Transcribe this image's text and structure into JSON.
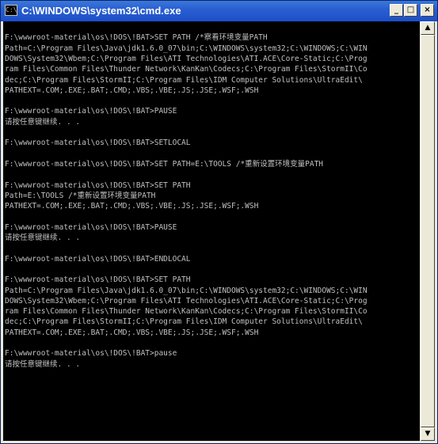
{
  "window": {
    "icon_text": "C:\\",
    "title": "C:\\WINDOWS\\system32\\cmd.exe",
    "buttons": {
      "minimize": "_",
      "maximize": "□",
      "close": "×"
    }
  },
  "console": {
    "lines": [
      "",
      "F:\\wwwroot-material\\os\\!DOS\\!BAT>SET PATH /*察看环境变量PATH",
      "Path=C:\\Program Files\\Java\\jdk1.6.0_07\\bin;C:\\WINDOWS\\system32;C:\\WINDOWS;C:\\WIN",
      "DOWS\\System32\\Wbem;C:\\Program Files\\ATI Technologies\\ATI.ACE\\Core-Static;C:\\Prog",
      "ram Files\\Common Files\\Thunder Network\\KanKan\\Codecs;C:\\Program Files\\StormII\\Co",
      "dec;C:\\Program Files\\StormII;C:\\Program Files\\IDM Computer Solutions\\UltraEdit\\",
      "PATHEXT=.COM;.EXE;.BAT;.CMD;.VBS;.VBE;.JS;.JSE;.WSF;.WSH",
      "",
      "F:\\wwwroot-material\\os\\!DOS\\!BAT>PAUSE",
      "请按任意键继续. . .",
      "",
      "F:\\wwwroot-material\\os\\!DOS\\!BAT>SETLOCAL",
      "",
      "F:\\wwwroot-material\\os\\!DOS\\!BAT>SET PATH=E:\\TOOLS /*重新设置环境变量PATH",
      "",
      "F:\\wwwroot-material\\os\\!DOS\\!BAT>SET PATH",
      "Path=E:\\TOOLS /*重新设置环境变量PATH",
      "PATHEXT=.COM;.EXE;.BAT;.CMD;.VBS;.VBE;.JS;.JSE;.WSF;.WSH",
      "",
      "F:\\wwwroot-material\\os\\!DOS\\!BAT>PAUSE",
      "请按任意键继续. . .",
      "",
      "F:\\wwwroot-material\\os\\!DOS\\!BAT>ENDLOCAL",
      "",
      "F:\\wwwroot-material\\os\\!DOS\\!BAT>SET PATH",
      "Path=C:\\Program Files\\Java\\jdk1.6.0_07\\bin;C:\\WINDOWS\\system32;C:\\WINDOWS;C:\\WIN",
      "DOWS\\System32\\Wbem;C:\\Program Files\\ATI Technologies\\ATI.ACE\\Core-Static;C:\\Prog",
      "ram Files\\Common Files\\Thunder Network\\KanKan\\Codecs;C:\\Program Files\\StormII\\Co",
      "dec;C:\\Program Files\\StormII;C:\\Program Files\\IDM Computer Solutions\\UltraEdit\\",
      "PATHEXT=.COM;.EXE;.BAT;.CMD;.VBS;.VBE;.JS;.JSE;.WSF;.WSH",
      "",
      "F:\\wwwroot-material\\os\\!DOS\\!BAT>pause",
      "请按任意键继续. . ."
    ]
  },
  "scrollbar": {
    "up_arrow": "▲",
    "down_arrow": "▼"
  },
  "colors": {
    "console_bg": "#000000",
    "console_text": "#c0c0c0",
    "titlebar": "#2a5fd2"
  }
}
